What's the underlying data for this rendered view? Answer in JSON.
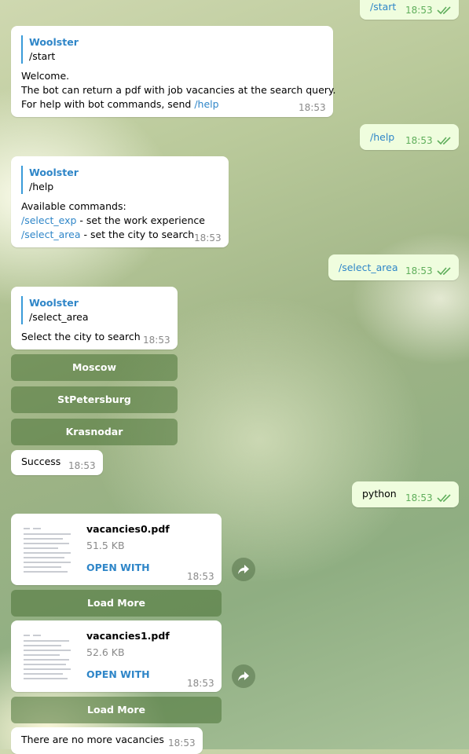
{
  "colors": {
    "accent": "#2f86c8",
    "out_bubble": "#effdde",
    "in_bubble": "#ffffff",
    "keyboard": "#4b7337"
  },
  "messages": {
    "start_out": {
      "text": "/start",
      "time": "18:53"
    },
    "welcome": {
      "reply_author": "Woolster",
      "reply_text": "/start",
      "line1": "Welcome.",
      "line2": "The bot can return a pdf with job vacancies at the search query.",
      "line3_prefix": "For help with bot commands, send ",
      "line3_cmd": "/help",
      "time": "18:53"
    },
    "help_out": {
      "text": "/help",
      "time": "18:53"
    },
    "help_reply": {
      "reply_author": "Woolster",
      "reply_text": "/help",
      "line1": "Available commands:",
      "cmd1": "/select_exp",
      "cmd1_desc": " - set the work experience",
      "cmd2": "/select_area",
      "cmd2_desc": " - set the city to search",
      "time": "18:53"
    },
    "select_area_out": {
      "text": "/select_area",
      "time": "18:53"
    },
    "select_area_reply": {
      "reply_author": "Woolster",
      "reply_text": "/select_area",
      "text": "Select the city to search",
      "time": "18:53"
    },
    "city_buttons": [
      "Moscow",
      "StPetersburg",
      "Krasnodar"
    ],
    "success": {
      "text": "Success",
      "time": "18:53"
    },
    "python_out": {
      "text": "python",
      "time": "18:53"
    },
    "doc1": {
      "name": "vacancies0.pdf",
      "size": "51.5 KB",
      "action": "OPEN WITH",
      "time": "18:53",
      "button": "Load More"
    },
    "doc2": {
      "name": "vacancies1.pdf",
      "size": "52.6 KB",
      "action": "OPEN WITH",
      "time": "18:53",
      "button": "Load More"
    },
    "no_more": {
      "text": "There are no more vacancies",
      "time": "18:53"
    }
  }
}
